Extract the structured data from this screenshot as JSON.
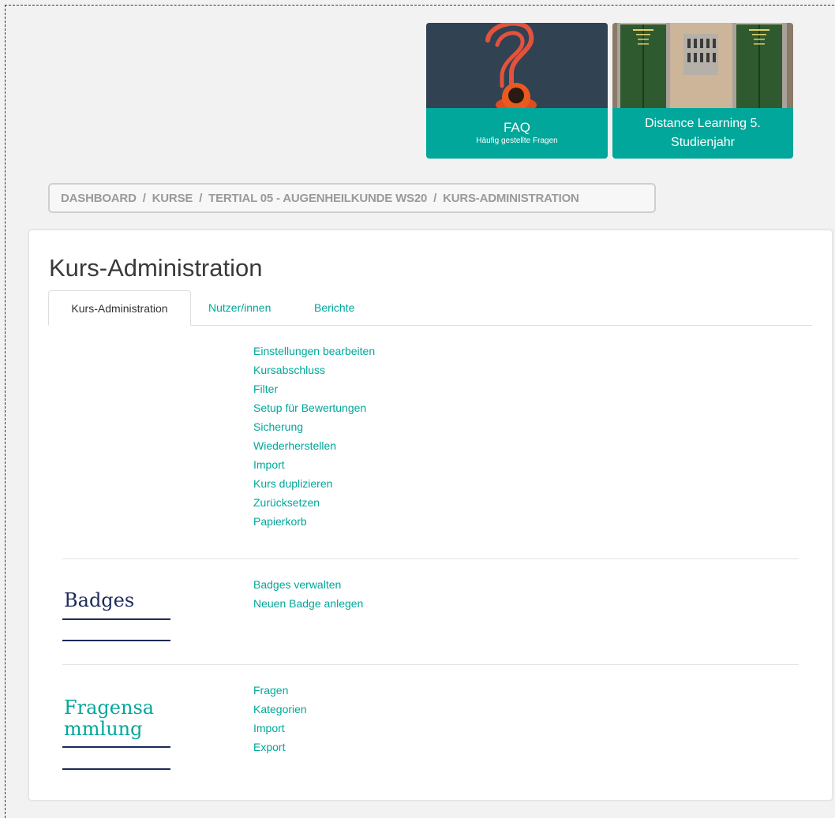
{
  "tiles": {
    "faq": {
      "title": "FAQ",
      "subtitle": "Häufig gestellte Fragen"
    },
    "distance": {
      "title_line1": "Distance Learning 5.",
      "title_line2": "Studienjahr"
    }
  },
  "breadcrumb": [
    "DASHBOARD",
    "KURSE",
    "TERTIAL 05 - AUGENHEILKUNDE WS20",
    "KURS-ADMINISTRATION"
  ],
  "breadcrumb_separator": "/",
  "page_title": "Kurs-Administration",
  "tabs": [
    {
      "label": "Kurs-Administration",
      "active": true
    },
    {
      "label": "Nutzer/innen",
      "active": false
    },
    {
      "label": "Berichte",
      "active": false
    }
  ],
  "sections": [
    {
      "heading": "",
      "links": [
        "Einstellungen bearbeiten",
        "Kursabschluss",
        "Filter",
        "Setup für Bewertungen",
        "Sicherung",
        "Wiederherstellen",
        "Import",
        "Kurs duplizieren",
        "Zurücksetzen",
        "Papierkorb"
      ]
    },
    {
      "heading": "Badges",
      "heading_color": "#1d2a5a",
      "links": [
        "Badges verwalten",
        "Neuen Badge anlegen"
      ]
    },
    {
      "heading_line1": "Fragensa",
      "heading_line2": "mmlung",
      "heading_color": "#00a79a",
      "links": [
        "Fragen",
        "Kategorien",
        "Import",
        "Export"
      ]
    }
  ],
  "colors": {
    "accent": "#00a79a",
    "navy": "#1d2a5a",
    "background": "#f2f2f2"
  }
}
